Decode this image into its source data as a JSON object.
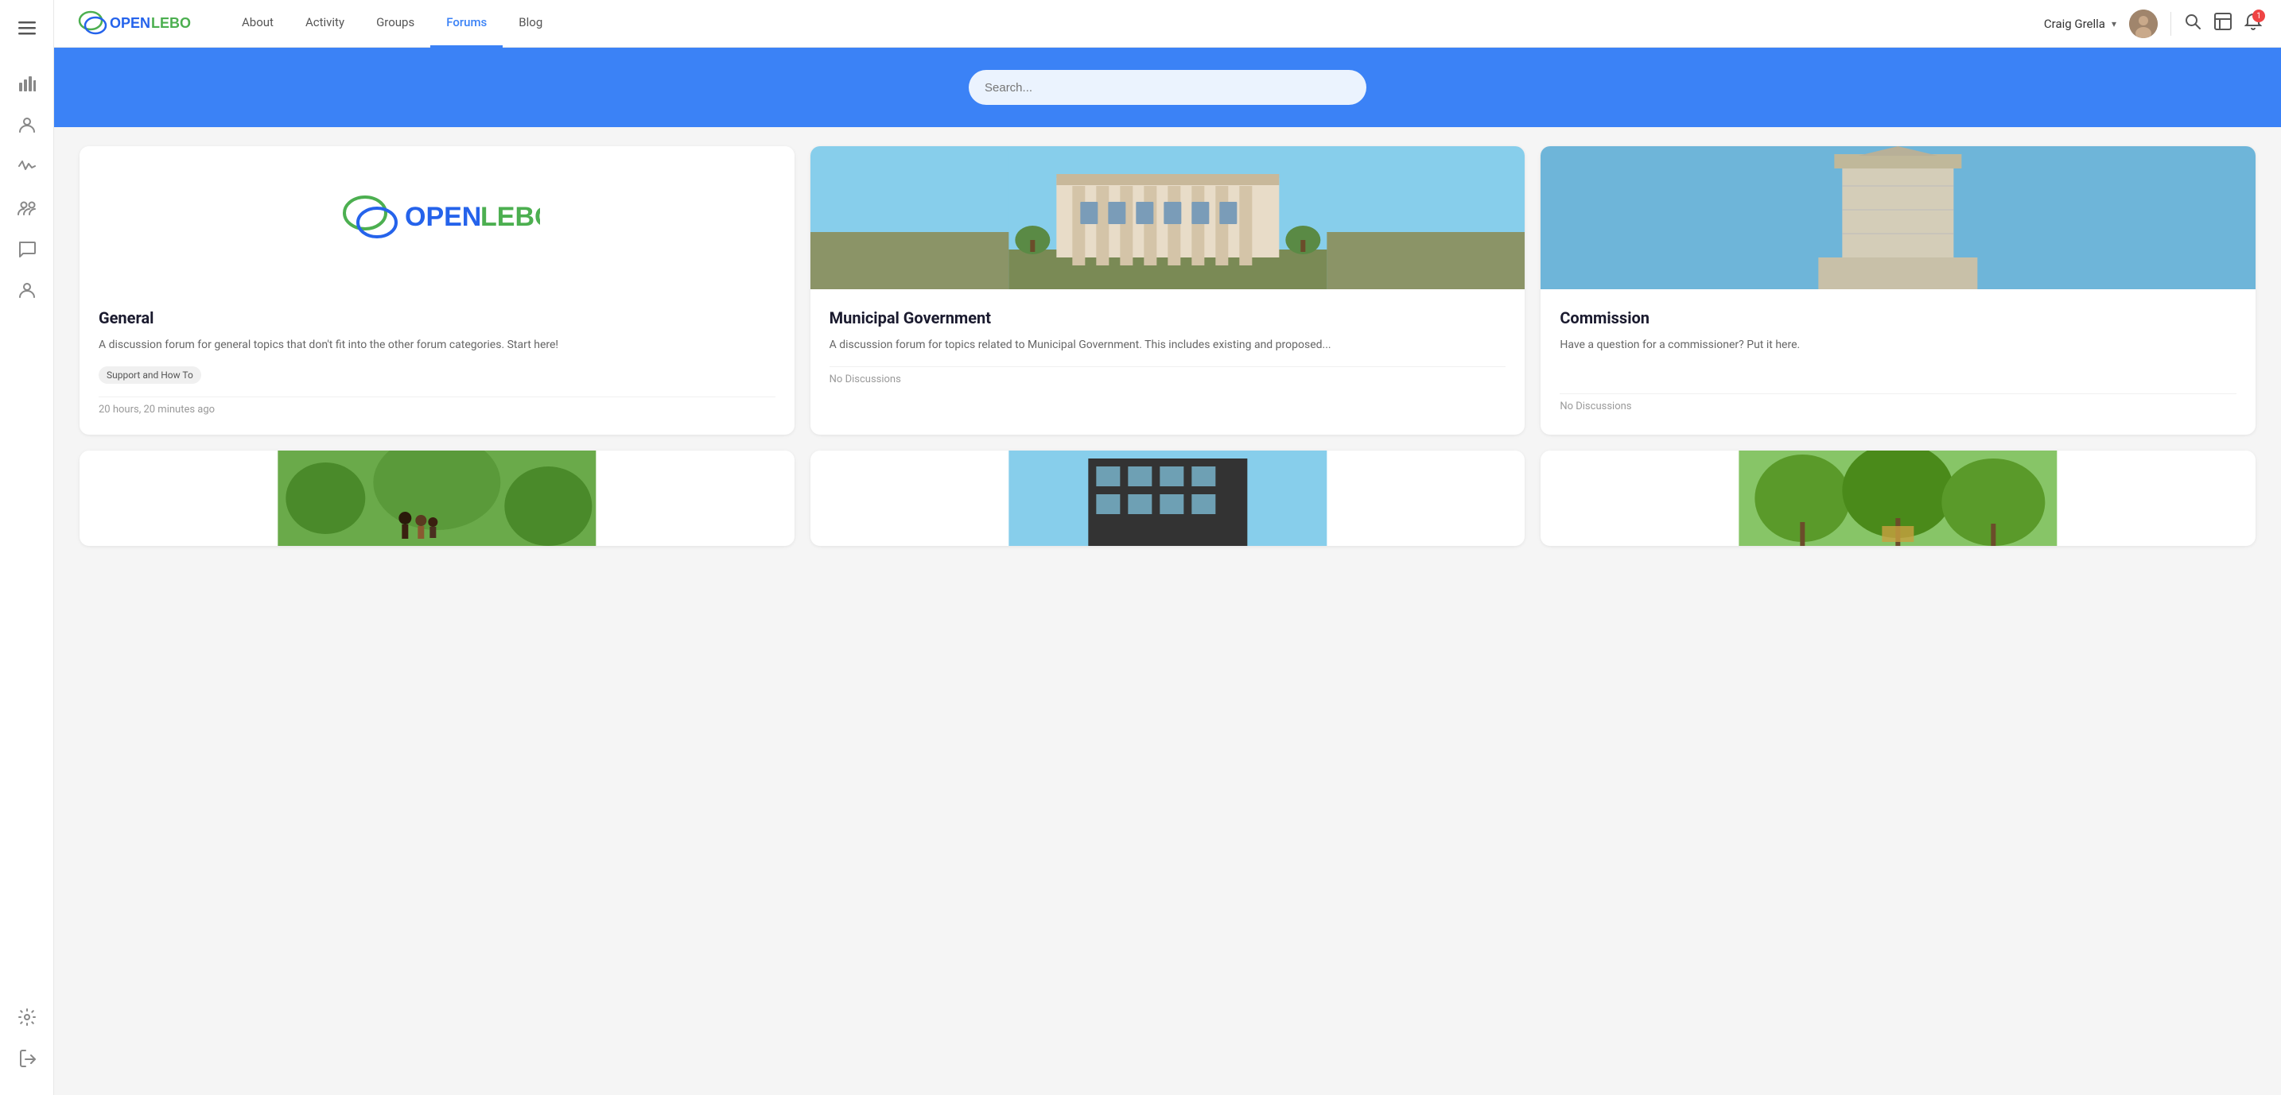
{
  "sidebar": {
    "menu_icon": "☰",
    "items": [
      {
        "name": "analytics-icon",
        "icon": "📊",
        "label": "Analytics"
      },
      {
        "name": "user-icon",
        "icon": "👤",
        "label": "Profile"
      },
      {
        "name": "activity-icon",
        "icon": "〜",
        "label": "Activity"
      },
      {
        "name": "groups-icon",
        "icon": "👥",
        "label": "Groups"
      },
      {
        "name": "messages-icon",
        "icon": "💬",
        "label": "Messages"
      },
      {
        "name": "members-icon",
        "icon": "👤",
        "label": "Members"
      }
    ],
    "bottom_items": [
      {
        "name": "settings-icon",
        "icon": "⚙️",
        "label": "Settings"
      },
      {
        "name": "logout-icon",
        "icon": "→",
        "label": "Logout"
      }
    ]
  },
  "header": {
    "logo_text_open": "OPEN",
    "logo_text_lebo": "LEBO",
    "nav_links": [
      {
        "label": "About",
        "active": false
      },
      {
        "label": "Activity",
        "active": false
      },
      {
        "label": "Groups",
        "active": false
      },
      {
        "label": "Forums",
        "active": true
      },
      {
        "label": "Blog",
        "active": false
      }
    ],
    "user_name": "Craig Grella",
    "notification_count": "1",
    "search_placeholder": ""
  },
  "hero": {
    "search_placeholder": "Search..."
  },
  "forums": {
    "cards": [
      {
        "id": "general",
        "title": "General",
        "description": "A discussion forum for general topics that don't fit into the other forum categories. Start here!",
        "tag": "Support and How To",
        "footer": "20 hours, 20 minutes ago",
        "has_image": false,
        "no_discussions": false
      },
      {
        "id": "municipal",
        "title": "Municipal Government",
        "description": "A discussion forum for topics related to Municipal Government. This includes existing and proposed...",
        "tag": null,
        "footer": "No Discussions",
        "has_image": true,
        "image_type": "municipal",
        "no_discussions": true
      },
      {
        "id": "commission",
        "title": "Commission",
        "description": "Have a question for a commissioner? Put it here.",
        "tag": null,
        "footer": "No Discussions",
        "has_image": true,
        "image_type": "commission",
        "no_discussions": true
      }
    ],
    "bottom_cards": [
      {
        "id": "park1",
        "image_type": "park-family",
        "title": "",
        "footer": ""
      },
      {
        "id": "modern1",
        "image_type": "modern-building",
        "title": "",
        "footer": ""
      },
      {
        "id": "park2",
        "image_type": "park-trees",
        "title": "",
        "footer": ""
      }
    ]
  }
}
